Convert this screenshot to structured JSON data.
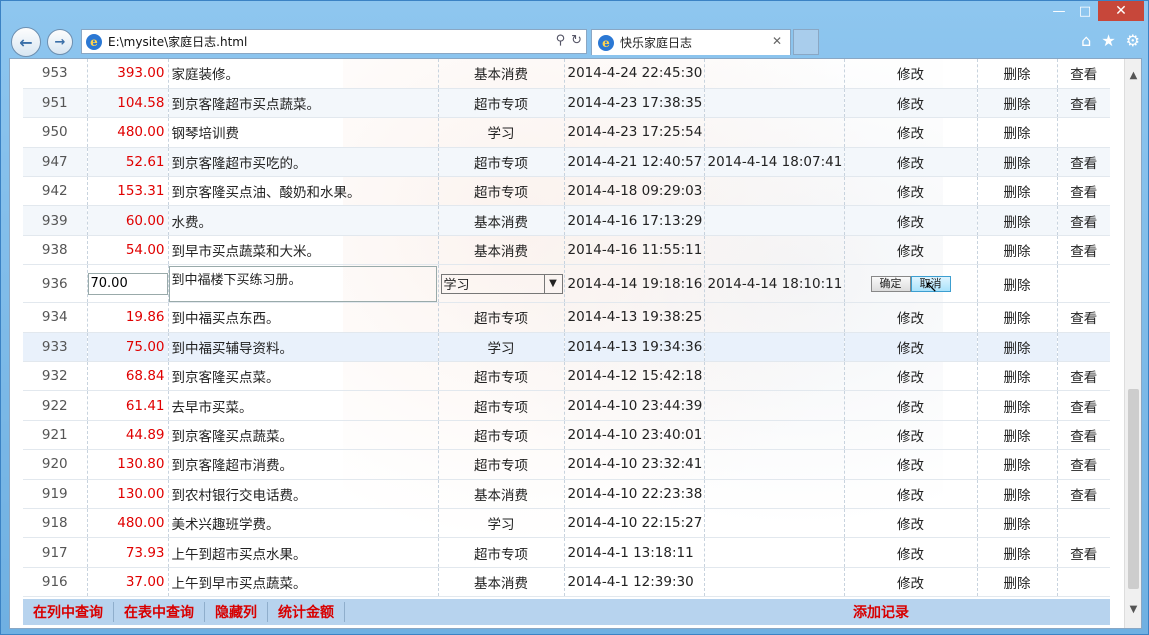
{
  "window": {
    "minimize": "—",
    "maximize": "□",
    "close": "✕"
  },
  "nav": {
    "back": "←",
    "forward": "→",
    "address": "E:\\mysite\\家庭日志.html",
    "search_icon": "⚲",
    "refresh_icon": "↻"
  },
  "tab": {
    "title": "快乐家庭日志",
    "close": "✕"
  },
  "toolbar": {
    "home": "⌂",
    "favorites": "★",
    "settings": "⚙"
  },
  "rows": [
    {
      "id": "953",
      "amount": "393.00",
      "desc": "家庭装修。",
      "cat": "基本消费",
      "time": "2014-4-24 22:45:30",
      "time2": "",
      "edit": "修改",
      "del": "删除",
      "view": "查看"
    },
    {
      "id": "951",
      "amount": "104.58",
      "desc": "到京客隆超市买点蔬菜。",
      "cat": "超市专项",
      "time": "2014-4-23 17:38:35",
      "time2": "",
      "edit": "修改",
      "del": "删除",
      "view": "查看"
    },
    {
      "id": "950",
      "amount": "480.00",
      "desc": "钢琴培训费",
      "cat": "学习",
      "time": "2014-4-23 17:25:54",
      "time2": "",
      "edit": "修改",
      "del": "删除",
      "view": ""
    },
    {
      "id": "947",
      "amount": "52.61",
      "desc": "到京客隆超市买吃的。",
      "cat": "超市专项",
      "time": "2014-4-21 12:40:57",
      "time2": "2014-4-14 18:07:41",
      "edit": "修改",
      "del": "删除",
      "view": "查看"
    },
    {
      "id": "942",
      "amount": "153.31",
      "desc": "到京客隆买点油、酸奶和水果。",
      "cat": "超市专项",
      "time": "2014-4-18 09:29:03",
      "time2": "",
      "edit": "修改",
      "del": "删除",
      "view": "查看"
    },
    {
      "id": "939",
      "amount": "60.00",
      "desc": "水费。",
      "cat": "基本消费",
      "time": "2014-4-16 17:13:29",
      "time2": "",
      "edit": "修改",
      "del": "删除",
      "view": "查看"
    },
    {
      "id": "938",
      "amount": "54.00",
      "desc": "到早市买点蔬菜和大米。",
      "cat": "基本消费",
      "time": "2014-4-16 11:55:11",
      "time2": "",
      "edit": "修改",
      "del": "删除",
      "view": "查看"
    }
  ],
  "edit_row": {
    "id": "936",
    "amount": "70.00",
    "desc": "到中福楼下买练习册。",
    "cat": "学习",
    "time": "2014-4-14 19:18:16",
    "time2": "2014-4-14 18:10:11",
    "confirm": "确定",
    "cancel": "取消",
    "del": "删除"
  },
  "rows2": [
    {
      "id": "934",
      "amount": "19.86",
      "desc": "到中福买点东西。",
      "cat": "超市专项",
      "time": "2014-4-13 19:38:25",
      "time2": "",
      "edit": "修改",
      "del": "删除",
      "view": "查看"
    },
    {
      "id": "933",
      "amount": "75.00",
      "desc": "到中福买辅导资料。",
      "cat": "学习",
      "time": "2014-4-13 19:34:36",
      "time2": "",
      "edit": "修改",
      "del": "删除",
      "view": ""
    },
    {
      "id": "932",
      "amount": "68.84",
      "desc": "到京客隆买点菜。",
      "cat": "超市专项",
      "time": "2014-4-12 15:42:18",
      "time2": "",
      "edit": "修改",
      "del": "删除",
      "view": "查看"
    },
    {
      "id": "922",
      "amount": "61.41",
      "desc": "去早市买菜。",
      "cat": "超市专项",
      "time": "2014-4-10 23:44:39",
      "time2": "",
      "edit": "修改",
      "del": "删除",
      "view": "查看"
    },
    {
      "id": "921",
      "amount": "44.89",
      "desc": "到京客隆买点蔬菜。",
      "cat": "超市专项",
      "time": "2014-4-10 23:40:01",
      "time2": "",
      "edit": "修改",
      "del": "删除",
      "view": "查看"
    },
    {
      "id": "920",
      "amount": "130.80",
      "desc": "到京客隆超市消费。",
      "cat": "超市专项",
      "time": "2014-4-10 23:32:41",
      "time2": "",
      "edit": "修改",
      "del": "删除",
      "view": "查看"
    },
    {
      "id": "919",
      "amount": "130.00",
      "desc": "到农村银行交电话费。",
      "cat": "基本消费",
      "time": "2014-4-10 22:23:38",
      "time2": "",
      "edit": "修改",
      "del": "删除",
      "view": "查看"
    },
    {
      "id": "918",
      "amount": "480.00",
      "desc": "美术兴趣班学费。",
      "cat": "学习",
      "time": "2014-4-10 22:15:27",
      "time2": "",
      "edit": "修改",
      "del": "删除",
      "view": ""
    },
    {
      "id": "917",
      "amount": "73.93",
      "desc": "上午到超市买点水果。",
      "cat": "超市专项",
      "time": "2014-4-1 13:18:11",
      "time2": "",
      "edit": "修改",
      "del": "删除",
      "view": "查看"
    },
    {
      "id": "916",
      "amount": "37.00",
      "desc": "上午到早市买点蔬菜。",
      "cat": "基本消费",
      "time": "2014-4-1 12:39:30",
      "time2": "",
      "edit": "修改",
      "del": "删除",
      "view": ""
    }
  ],
  "footer": {
    "links": [
      "在列中查询",
      "在表中查询",
      "隐藏列",
      "统计金额"
    ],
    "add": "添加记录"
  }
}
